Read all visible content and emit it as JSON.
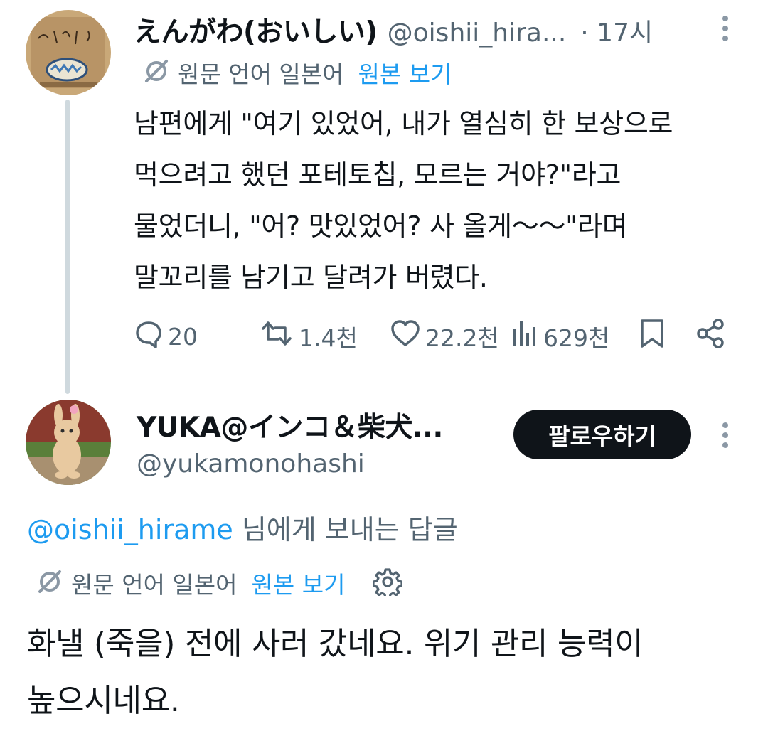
{
  "tweet": {
    "display_name": "えんがわ(おいしい)",
    "handle": "@oishii_hira...",
    "time": "· 17시",
    "translation": {
      "lang_label": "원문 언어 일본어",
      "view_original": "원본 보기"
    },
    "body_lines": [
      "남편에게 \"여기 있었어, 내가 열심히 한 보상으로",
      "먹으려고 했던 포테토칩, 모르는 거야?\"라고",
      "물었더니, \"어? 맛있었어? 사 올게～～\"라며",
      "말꼬리를 남기고 달려가 버렸다."
    ],
    "stats": {
      "replies": "20",
      "retweets": "1.4천",
      "likes": "22.2천",
      "views": "629천"
    }
  },
  "reply": {
    "display_name": "YUKA@インコ＆柴犬...",
    "handle": "@yukamonohashi",
    "follow_label": "팔로우하기",
    "replying_to": {
      "mention": "@oishii_hirame",
      "suffix": " 님에게 보내는 답글"
    },
    "translation": {
      "lang_label": "원문 언어 일본어",
      "view_original": "원본 보기"
    },
    "body_lines": [
      "화낼 (죽을) 전에 사러 갔네요. 위기 관리 능력이",
      "높으시네요."
    ]
  },
  "colors": {
    "link": "#1d9bf0",
    "muted": "#536471",
    "text": "#0f1419",
    "thread_line": "#cfd9de"
  }
}
